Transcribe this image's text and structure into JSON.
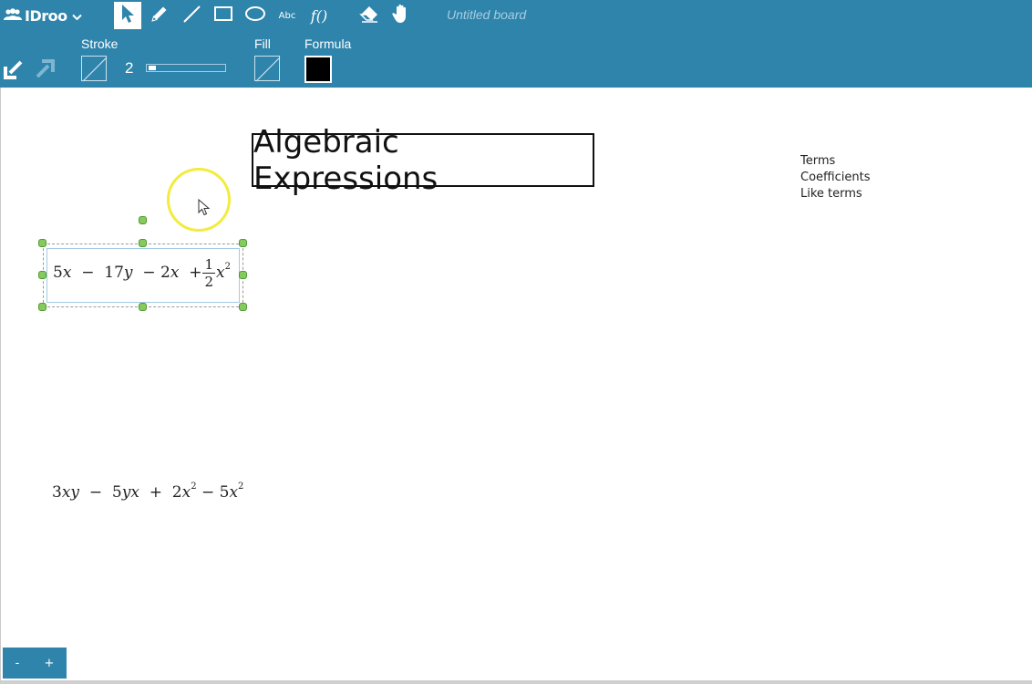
{
  "app": {
    "logo_text": "IDroo",
    "board_title": "Untitled board"
  },
  "toolbar": {
    "tools": [
      {
        "name": "select-tool",
        "icon": "pointer-icon",
        "active": true
      },
      {
        "name": "pen-tool",
        "icon": "pencil-icon"
      },
      {
        "name": "line-tool",
        "icon": "line-icon"
      },
      {
        "name": "rectangle-tool",
        "icon": "rectangle-icon"
      },
      {
        "name": "ellipse-tool",
        "icon": "ellipse-icon"
      },
      {
        "name": "text-tool",
        "icon": "text-icon",
        "label": "Abc"
      },
      {
        "name": "formula-tool",
        "icon": "formula-icon",
        "label": "f()"
      },
      {
        "name": "eraser-tool",
        "icon": "eraser-icon"
      },
      {
        "name": "pan-tool",
        "icon": "hand-icon"
      }
    ],
    "text_tool_label": "Abc",
    "formula_tool_label": "f()"
  },
  "properties": {
    "stroke_label": "Stroke",
    "stroke_width": "2",
    "stroke_width_fraction": 0.1,
    "fill_label": "Fill",
    "formula_label": "Formula",
    "formula_color": "#000000"
  },
  "board": {
    "title": "Algebraic Expressions",
    "notes": [
      "Terms",
      "Coefficients",
      "Like terms"
    ]
  },
  "zoom": {
    "minus": "-",
    "plus": "+"
  },
  "colors": {
    "toolbar": "#2e84ab",
    "handle": "#86c95e",
    "highlight": "#f1ec3e"
  }
}
